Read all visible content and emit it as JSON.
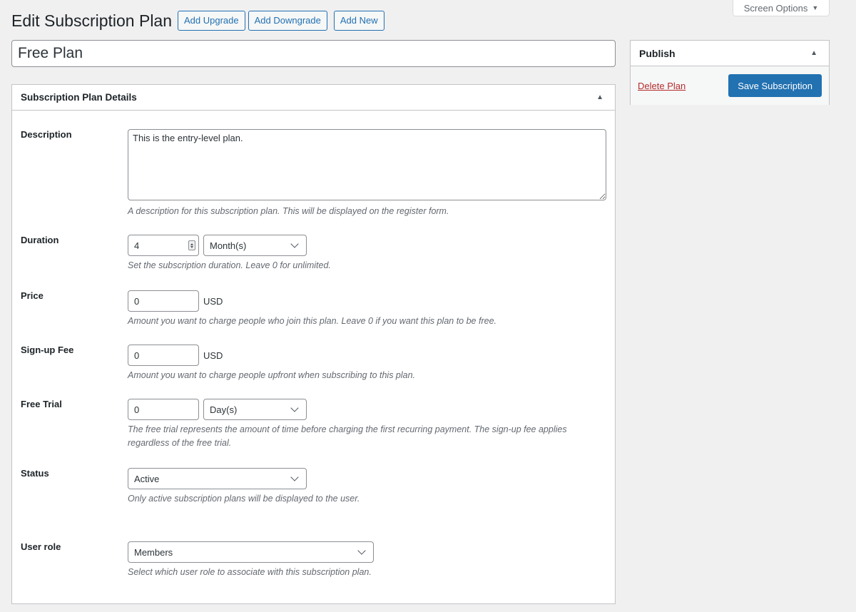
{
  "screen_options": {
    "label": "Screen Options"
  },
  "header": {
    "title": "Edit Subscription Plan",
    "actions": [
      "Add Upgrade",
      "Add Downgrade",
      "Add New"
    ]
  },
  "plan_title": {
    "value": "Free Plan"
  },
  "publish": {
    "title": "Publish",
    "delete_label": "Delete Plan",
    "save_label": "Save Subscription"
  },
  "details": {
    "title": "Subscription Plan Details",
    "description": {
      "label": "Description",
      "value": "This is the entry-level plan.",
      "help": "A description for this subscription plan. This will be displayed on the register form."
    },
    "duration": {
      "label": "Duration",
      "value": "4",
      "unit": "Month(s)",
      "help": "Set the subscription duration. Leave 0 for unlimited."
    },
    "price": {
      "label": "Price",
      "value": "0",
      "currency": "USD",
      "help": "Amount you want to charge people who join this plan. Leave 0 if you want this plan to be free."
    },
    "signup_fee": {
      "label": "Sign-up Fee",
      "value": "0",
      "currency": "USD",
      "help": "Amount you want to charge people upfront when subscribing to this plan."
    },
    "free_trial": {
      "label": "Free Trial",
      "value": "0",
      "unit": "Day(s)",
      "help": "The free trial represents the amount of time before charging the first recurring payment. The sign-up fee applies regardless of the free trial."
    },
    "status": {
      "label": "Status",
      "value": "Active",
      "help": "Only active subscription plans will be displayed to the user."
    },
    "user_role": {
      "label": "User role",
      "value": "Members",
      "help": "Select which user role to associate with this subscription plan."
    }
  }
}
